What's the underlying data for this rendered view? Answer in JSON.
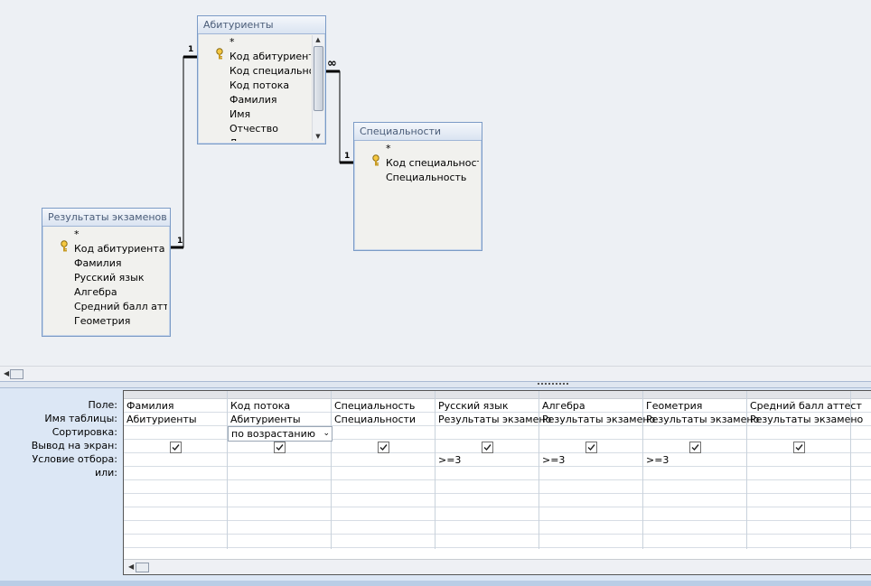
{
  "tables": [
    {
      "id": "abit",
      "title": "Абитуриенты",
      "fields": [
        "*",
        "Код абитуриента",
        "Код специальнос",
        "Код потока",
        "Фамилия",
        "Имя",
        "Отчество",
        "Д"
      ],
      "key_index": 1,
      "has_scrollbar": true
    },
    {
      "id": "spec",
      "title": "Специальности",
      "fields": [
        "*",
        "Код специальности",
        "Специальность"
      ],
      "key_index": 1,
      "has_scrollbar": false
    },
    {
      "id": "res",
      "title": "Результаты экзаменов",
      "fields": [
        "*",
        "Код абитуриента",
        "Фамилия",
        "Русский язык",
        "Алгебра",
        "Средний балл аттес",
        "Геометрия"
      ],
      "key_index": 1,
      "has_scrollbar": false
    }
  ],
  "relations": [
    {
      "label_from": "1",
      "label_to": "1"
    },
    {
      "label_from": "∞",
      "label_to": "1"
    }
  ],
  "grid": {
    "row_labels": [
      "Поле:",
      "Имя таблицы:",
      "Сортировка:",
      "Вывод на экран:",
      "Условие отбора:",
      "или:"
    ],
    "columns": [
      {
        "field": "Фамилия",
        "table": "Абитуриенты",
        "sort": "",
        "show": true,
        "criteria": ""
      },
      {
        "field": "Код потока",
        "table": "Абитуриенты",
        "sort": "по возрастанию",
        "show": true,
        "criteria": ""
      },
      {
        "field": "Специальность",
        "table": "Специальности",
        "sort": "",
        "show": true,
        "criteria": ""
      },
      {
        "field": "Русский язык",
        "table": "Результаты экзамено",
        "sort": "",
        "show": true,
        "criteria": ">=3"
      },
      {
        "field": "Алгебра",
        "table": "Результаты экзамено",
        "sort": "",
        "show": true,
        "criteria": ">=3"
      },
      {
        "field": "Геометрия",
        "table": "Результаты экзамено",
        "sort": "",
        "show": true,
        "criteria": ">=3"
      },
      {
        "field": "Средний балл аттест",
        "table": "Результаты экзамено",
        "sort": "",
        "show": true,
        "criteria": ""
      }
    ]
  },
  "icons": {
    "key": "key-icon",
    "scroll_left": "scroll-left-icon",
    "dropdown": "chevron-down-icon"
  }
}
